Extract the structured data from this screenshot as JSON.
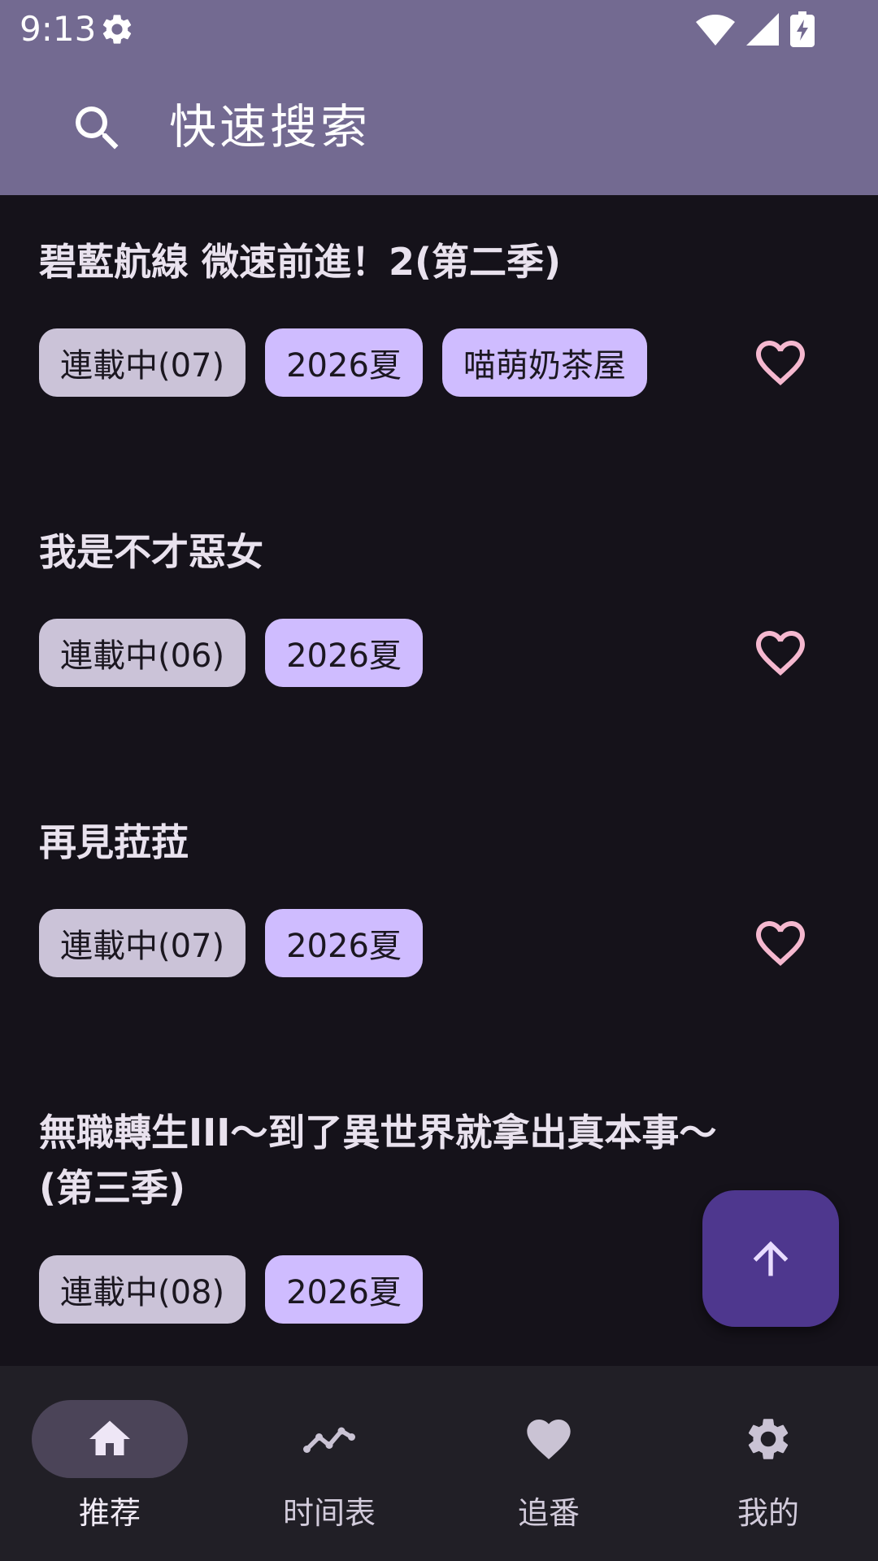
{
  "status_bar": {
    "time": "9:13",
    "icons": [
      "settings-icon",
      "wifi-icon",
      "signal-icon",
      "battery-charging-icon"
    ]
  },
  "app_bar": {
    "search_label": "快速搜索",
    "icon": "search-icon"
  },
  "colors": {
    "app_bar": "#736a91",
    "background": "#15121a",
    "tag_status": "#cbc3d8",
    "tag_season": "#cfbcff",
    "heart": "#f5b8cf",
    "fab": "#4e378e",
    "nav_bar": "#211f26",
    "nav_active_pill": "#4b4458"
  },
  "items": [
    {
      "title": "碧藍航線 微速前進！2(第二季)",
      "tags": [
        "連載中(07)",
        "2026夏",
        "喵萌奶茶屋"
      ]
    },
    {
      "title": "我是不才惡女",
      "tags": [
        "連載中(06)",
        "2026夏"
      ]
    },
    {
      "title": "再見菈菈",
      "tags": [
        "連載中(07)",
        "2026夏"
      ]
    },
    {
      "title": "無職轉生III～到了異世界就拿出真本事～(第三季)",
      "tags": [
        "連載中(08)",
        "2026夏"
      ]
    }
  ],
  "fab": {
    "icon": "arrow-up-icon"
  },
  "nav": [
    {
      "label": "推荐",
      "icon": "home-icon",
      "active": true
    },
    {
      "label": "时间表",
      "icon": "trending-icon",
      "active": false
    },
    {
      "label": "追番",
      "icon": "heart-icon",
      "active": false
    },
    {
      "label": "我的",
      "icon": "gear-icon",
      "active": false
    }
  ]
}
